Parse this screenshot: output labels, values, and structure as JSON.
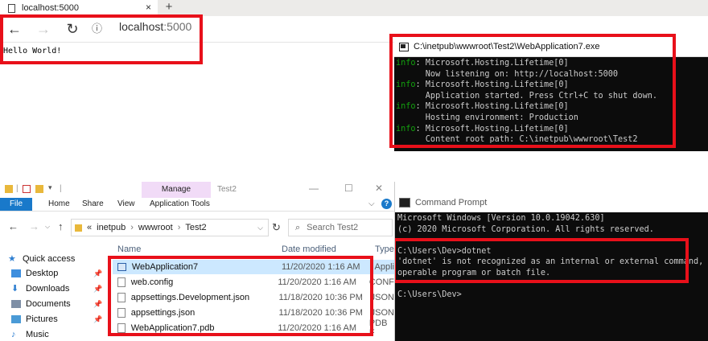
{
  "browser": {
    "tab_title": "localhost:5000",
    "close_glyph": "×",
    "new_tab_glyph": "+",
    "address_host": "localhost",
    "address_port": ":5000",
    "back_glyph": "←",
    "forward_glyph": "→",
    "refresh_glyph": "↻",
    "info_glyph": "ⓘ",
    "page_text": "Hello World!"
  },
  "console1": {
    "title": "C:\\inetpub\\wwwroot\\Test2\\WebApplication7.exe",
    "lines": [
      {
        "prefix": "info",
        "text": ": Microsoft.Hosting.Lifetime[0]"
      },
      {
        "prefix": "",
        "text": "      Now listening on: http://localhost:5000"
      },
      {
        "prefix": "info",
        "text": ": Microsoft.Hosting.Lifetime[0]"
      },
      {
        "prefix": "",
        "text": "      Application started. Press Ctrl+C to shut down."
      },
      {
        "prefix": "info",
        "text": ": Microsoft.Hosting.Lifetime[0]"
      },
      {
        "prefix": "",
        "text": "      Hosting environment: Production"
      },
      {
        "prefix": "info",
        "text": ": Microsoft.Hosting.Lifetime[0]"
      },
      {
        "prefix": "",
        "text": "      Content root path: C:\\inetpub\\wwwroot\\Test2"
      }
    ]
  },
  "console2": {
    "title": "Command Prompt",
    "lines": [
      "Microsoft Windows [Version 10.0.19042.630]",
      "(c) 2020 Microsoft Corporation. All rights reserved.",
      "",
      "C:\\Users\\Dev>dotnet",
      "'dotnet' is not recognized as an internal or external command,",
      "operable program or batch file.",
      "",
      "C:\\Users\\Dev>"
    ]
  },
  "explorer": {
    "manage_label": "Manage",
    "window_title": "Test2",
    "ribbon_tabs": [
      "File",
      "Home",
      "Share",
      "View",
      "Application Tools"
    ],
    "breadcrumb": [
      "«",
      "inetpub",
      "wwwroot",
      "Test2"
    ],
    "search_placeholder": "Search Test2",
    "columns": {
      "name": "Name",
      "date": "Date modified",
      "type": "Type"
    },
    "nav": [
      {
        "label": "Quick access"
      },
      {
        "label": "Desktop"
      },
      {
        "label": "Downloads"
      },
      {
        "label": "Documents"
      },
      {
        "label": "Pictures"
      },
      {
        "label": "Music"
      }
    ],
    "files": [
      {
        "name": "WebApplication7",
        "date": "11/20/2020 1:16 AM",
        "type": "Appli"
      },
      {
        "name": "web.config",
        "date": "11/20/2020 1:16 AM",
        "type": "CONF"
      },
      {
        "name": "appsettings.Development.json",
        "date": "11/18/2020 10:36 PM",
        "type": "JSON"
      },
      {
        "name": "appsettings.json",
        "date": "11/18/2020 10:36 PM",
        "type": "JSON"
      },
      {
        "name": "WebApplication7.pdb",
        "date": "11/20/2020 1:16 AM",
        "type": "PDB F"
      }
    ],
    "min_glyph": "—",
    "max_glyph": "☐",
    "close_glyph": "✕",
    "help_glyph": "?"
  },
  "colors": {
    "highlight_red": "#e8101a",
    "console_info_green": "#13a10e",
    "file_tab_blue": "#1979ca",
    "manage_purple": "#f1dbf7"
  }
}
